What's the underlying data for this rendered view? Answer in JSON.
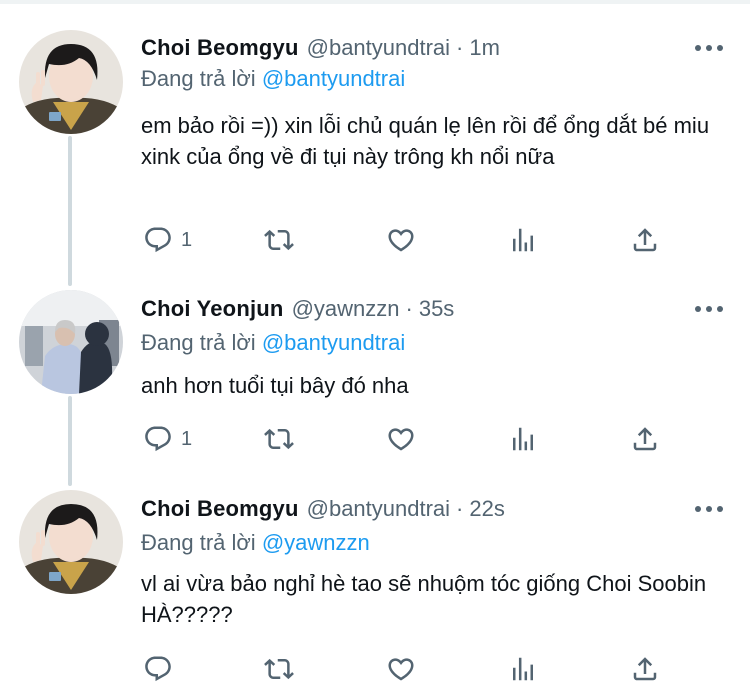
{
  "tweets": [
    {
      "name": "Choi Beomgyu",
      "handle": "@bantyundtrai",
      "dot": "·",
      "time": "1m",
      "replying_prefix": "Đang trả lời",
      "replying_to": "@bantyundtrai",
      "text": "em bảo rồi =)) xin lỗi chủ quán lẹ lên rồi để ổng dắt bé miu xink của ổng về đi tụi này trông kh nổi nữa",
      "reply_count": "1",
      "avatar": "beomgyu-avatar"
    },
    {
      "name": "Choi Yeonjun",
      "handle": "@yawnzzn",
      "dot": "·",
      "time": "35s",
      "replying_prefix": "Đang trả lời",
      "replying_to": "@bantyundtrai",
      "text": "anh hơn tuổi tụi bây đó nha",
      "reply_count": "1",
      "avatar": "yeonjun-avatar"
    },
    {
      "name": "Choi Beomgyu",
      "handle": "@bantyundtrai",
      "dot": "·",
      "time": "22s",
      "replying_prefix": "Đang trả lời",
      "replying_to": "@yawnzzn",
      "text": "vl ai vừa bảo nghỉ hè tao sẽ nhuộm tóc giống Choi Soobin HÀ?????",
      "reply_count": "",
      "avatar": "beomgyu-avatar"
    }
  ],
  "colors": {
    "accent": "#1d9bf0",
    "secondary_text": "#536471",
    "primary_text": "#0f1419",
    "thread_line": "#cfd9de"
  },
  "icons": [
    "reply-icon",
    "retweet-icon",
    "like-icon",
    "views-icon",
    "share-icon",
    "more-icon"
  ]
}
